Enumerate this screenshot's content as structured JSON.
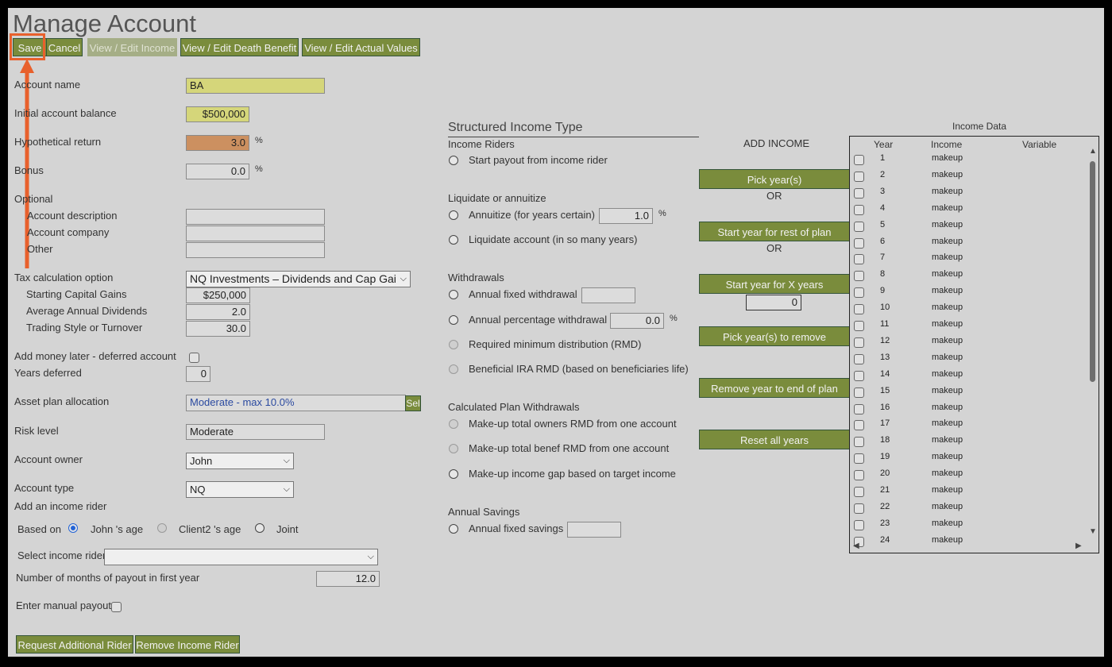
{
  "page_title": "Manage Account",
  "toolbar": {
    "save": "Save",
    "cancel": "Cancel",
    "view_income": "View / Edit Income",
    "view_death": "View / Edit Death Benefit",
    "view_actual": "View / Edit Actual Values"
  },
  "form": {
    "account_name_label": "Account name",
    "account_name_value": "BA",
    "initial_balance_label": "Initial account balance",
    "initial_balance_value": "$500,000",
    "hyp_return_label": "Hypothetical return",
    "hyp_return_value": "3.0",
    "bonus_label": "Bonus",
    "bonus_value": "0.0",
    "percent": "%",
    "optional_label": "Optional",
    "account_description_label": "Account description",
    "account_company_label": "Account company",
    "other_label": "Other",
    "tax_option_label": "Tax calculation option",
    "tax_option_value": "NQ Investments – Dividends and Cap Gai",
    "starting_cap_gains_label": "Starting Capital Gains",
    "starting_cap_gains_value": "$250,000",
    "avg_dividends_label": "Average Annual Dividends",
    "avg_dividends_value": "2.0",
    "trading_style_label": "Trading Style or Turnover",
    "trading_style_value": "30.0",
    "add_money_label": "Add money later - deferred account",
    "years_deferred_label": "Years deferred",
    "years_deferred_value": "0",
    "asset_plan_label": "Asset plan allocation",
    "asset_plan_value": "Moderate - max 10.0%",
    "sel_button": "Sel",
    "risk_label": "Risk level",
    "risk_value": "Moderate",
    "owner_label": "Account owner",
    "owner_value": "John",
    "type_label": "Account type",
    "type_value": "NQ",
    "add_rider_label": "Add an income rider",
    "based_on_label": "Based on",
    "based_john": "John 's age",
    "based_client2": "Client2 's age",
    "based_joint": "Joint",
    "select_rider_label": "Select income rider",
    "months_payout_label": "Number of months of payout in first year",
    "months_payout_value": "12.0",
    "manual_payout_label": "Enter manual payout",
    "request_rider_button": "Request Additional Rider",
    "remove_rider_button": "Remove Income Rider"
  },
  "structured": {
    "title": "Structured Income Type",
    "income_riders": "Income Riders",
    "start_payout": "Start payout from income rider",
    "liquidate_header": "Liquidate or annuitize",
    "annuitize": "Annuitize (for years certain)",
    "annuitize_value": "1.0",
    "liquidate": "Liquidate account (in so many years)",
    "withdrawals_header": "Withdrawals",
    "annual_fixed": "Annual fixed withdrawal",
    "annual_pct": "Annual percentage withdrawal",
    "annual_pct_value": "0.0",
    "rmd": "Required minimum distribution (RMD)",
    "benef_rmd": "Beneficial IRA RMD (based on beneficiaries life)",
    "calc_header": "Calculated Plan Withdrawals",
    "makeup_owners": "Make-up total owners RMD from one account",
    "makeup_benef": "Make-up total benef RMD from one account",
    "makeup_gap": "Make-up income gap based on target income",
    "savings_header": "Annual Savings",
    "annual_savings": "Annual fixed savings"
  },
  "add_income": {
    "title": "ADD INCOME",
    "pick_years": "Pick year(s)",
    "or1": "OR",
    "start_rest": "Start year for rest of plan",
    "or2": "OR",
    "start_x": "Start year for X years",
    "x_years_value": "0",
    "pick_remove": "Pick year(s) to remove",
    "remove_end": "Remove year to end of plan",
    "reset_all": "Reset all years"
  },
  "income_data": {
    "title": "Income Data",
    "col_year": "Year",
    "col_income": "Income",
    "col_variable": "Variable",
    "rows": [
      {
        "year": "1",
        "income": "makeup"
      },
      {
        "year": "2",
        "income": "makeup"
      },
      {
        "year": "3",
        "income": "makeup"
      },
      {
        "year": "4",
        "income": "makeup"
      },
      {
        "year": "5",
        "income": "makeup"
      },
      {
        "year": "6",
        "income": "makeup"
      },
      {
        "year": "7",
        "income": "makeup"
      },
      {
        "year": "8",
        "income": "makeup"
      },
      {
        "year": "9",
        "income": "makeup"
      },
      {
        "year": "10",
        "income": "makeup"
      },
      {
        "year": "11",
        "income": "makeup"
      },
      {
        "year": "12",
        "income": "makeup"
      },
      {
        "year": "13",
        "income": "makeup"
      },
      {
        "year": "14",
        "income": "makeup"
      },
      {
        "year": "15",
        "income": "makeup"
      },
      {
        "year": "16",
        "income": "makeup"
      },
      {
        "year": "17",
        "income": "makeup"
      },
      {
        "year": "18",
        "income": "makeup"
      },
      {
        "year": "19",
        "income": "makeup"
      },
      {
        "year": "20",
        "income": "makeup"
      },
      {
        "year": "21",
        "income": "makeup"
      },
      {
        "year": "22",
        "income": "makeup"
      },
      {
        "year": "23",
        "income": "makeup"
      },
      {
        "year": "24",
        "income": "makeup"
      }
    ]
  },
  "colors": {
    "button_green": "#7a8c3c",
    "highlight_orange": "#e8602c",
    "field_yellow": "#d5d67a",
    "field_orange": "#cc9060"
  }
}
